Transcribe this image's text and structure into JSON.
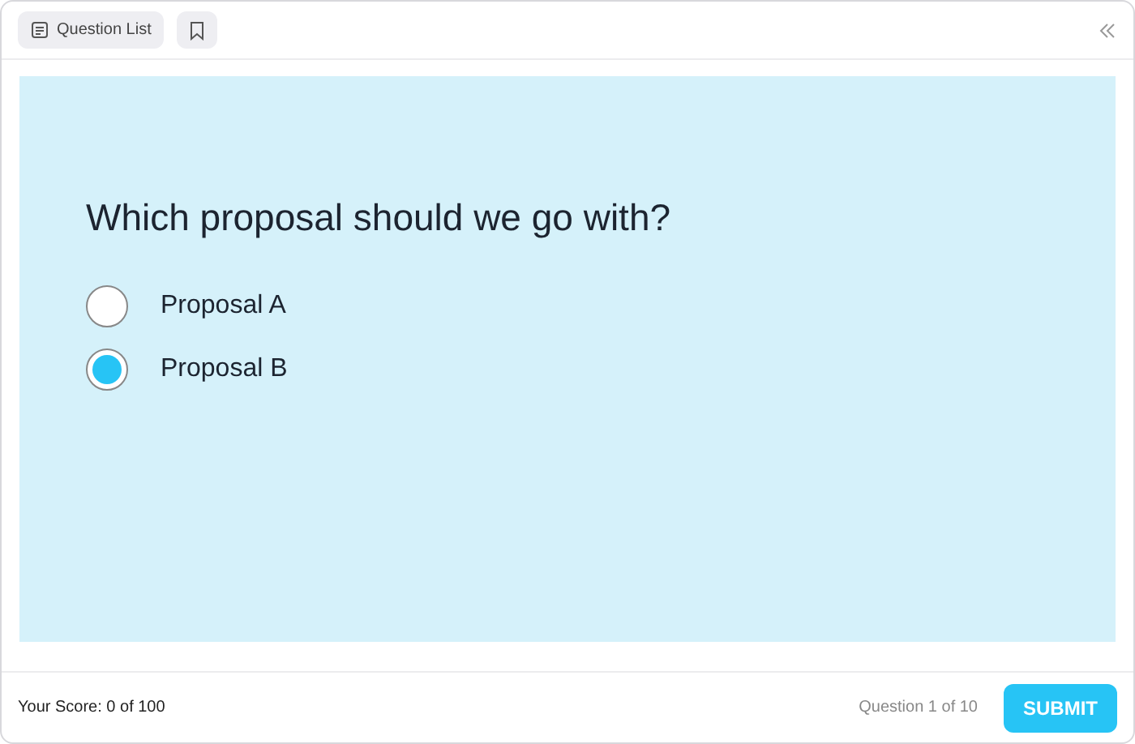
{
  "toolbar": {
    "question_list_button": "Question List"
  },
  "question": {
    "text": "Which proposal should we go with?",
    "options": [
      {
        "label": "Proposal A",
        "selected": false
      },
      {
        "label": "Proposal B",
        "selected": true
      }
    ]
  },
  "footer": {
    "score": "Your Score: 0 of 100",
    "progress": "Question 1 of 10",
    "submit_button": "SUBMIT"
  }
}
